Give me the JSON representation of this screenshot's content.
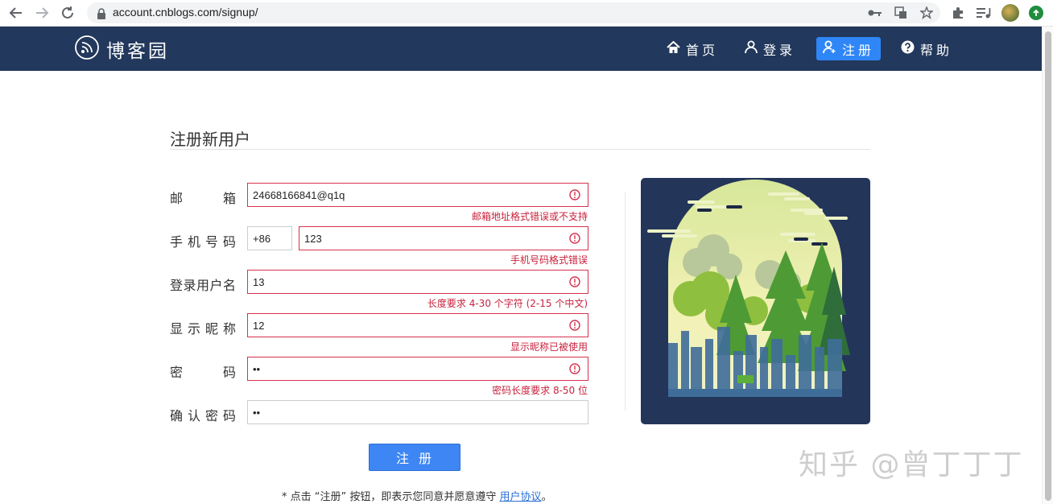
{
  "browser": {
    "url": "account.cnblogs.com/signup/",
    "icons": [
      "back-icon",
      "forward-icon",
      "reload-icon",
      "lock-icon",
      "key-icon",
      "translate-icon",
      "star-icon",
      "extensions-icon",
      "media-icon",
      "profile-avatar",
      "update-icon"
    ]
  },
  "site": {
    "logo_text": "博客园",
    "nav": [
      {
        "label": "首页",
        "icon": "home-icon"
      },
      {
        "label": "登录",
        "icon": "user-icon"
      },
      {
        "label": "注册",
        "icon": "user-add-icon",
        "active": true
      },
      {
        "label": "帮助",
        "icon": "help-icon"
      }
    ],
    "colors": {
      "navbar": "#22385c",
      "accent": "#2f86f6",
      "error": "#c8223d"
    }
  },
  "form": {
    "title": "注册新用户",
    "fields": {
      "email": {
        "label_chars": [
          "邮",
          "箱"
        ],
        "value": "24668166841@q1q",
        "error": "邮箱地址格式错误或不支持"
      },
      "phone": {
        "label_chars": [
          "手",
          "机",
          "号",
          "码"
        ],
        "prefix": "+86",
        "value": "123",
        "error": "手机号码格式错误"
      },
      "username": {
        "label_chars": [
          "登",
          "录",
          "用",
          "户",
          "名"
        ],
        "value": "13",
        "error": "长度要求 4-30 个字符 (2-15 个中文)"
      },
      "nickname": {
        "label_chars": [
          "显",
          "示",
          "昵",
          "称"
        ],
        "value": "12",
        "error": "显示昵称已被使用"
      },
      "password": {
        "label_chars": [
          "密",
          "码"
        ],
        "value": "••",
        "error": "密码长度要求 8-50 位"
      },
      "confirm": {
        "label_chars": [
          "确",
          "认",
          "密",
          "码"
        ],
        "value": "••"
      }
    },
    "submit_label": "注册",
    "agree_prefix": "* 点击 “注册” 按钮，即表示您同意并愿意遵守",
    "agree_link": "用户协议",
    "agree_suffix": "。"
  },
  "watermark": "知乎 @曾丁丁丁"
}
